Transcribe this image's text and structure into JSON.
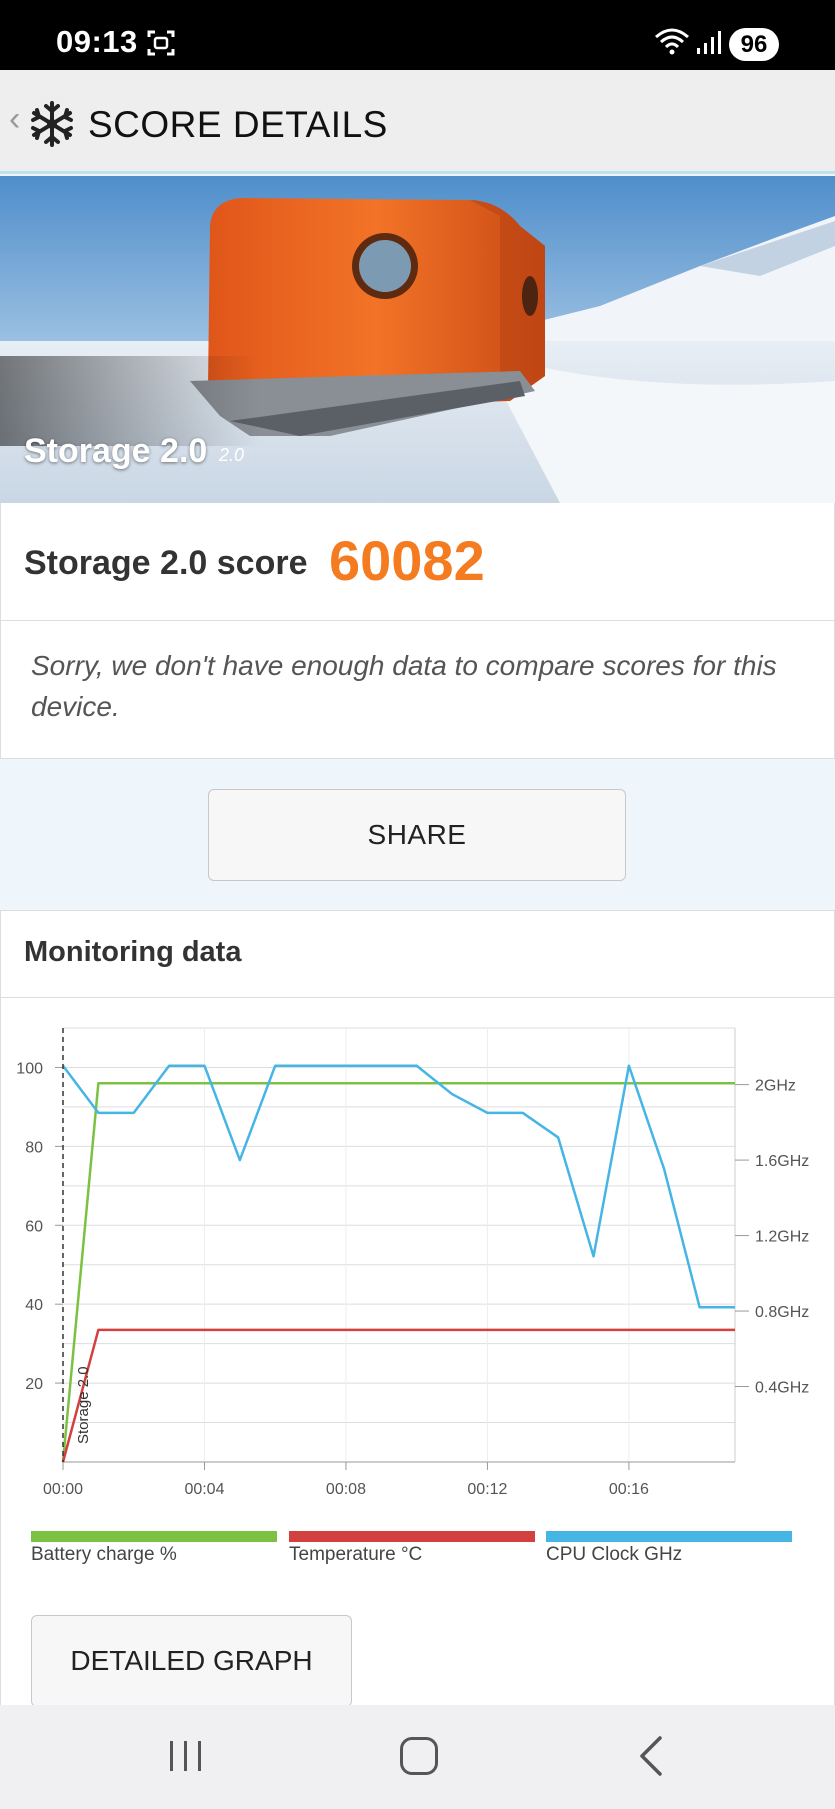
{
  "status_bar": {
    "time": "09:13",
    "battery": "96"
  },
  "app_bar": {
    "title": "SCORE DETAILS"
  },
  "hero": {
    "benchmark_name": "Storage 2.0",
    "version": "2.0"
  },
  "score": {
    "label": "Storage 2.0 score",
    "value": "60082",
    "accent_color": "#f47b20"
  },
  "compare": {
    "message": "Sorry, we don't have enough data to compare scores for this device."
  },
  "share_button": {
    "label": "SHARE"
  },
  "monitoring": {
    "title": "Monitoring data",
    "detailed_graph_label": "DETAILED GRAPH",
    "legend": [
      {
        "label": "Battery charge %",
        "color": "#7cc242"
      },
      {
        "label": "Temperature °C",
        "color": "#d2403f"
      },
      {
        "label": "CPU Clock GHz",
        "color": "#45b5e6"
      }
    ]
  },
  "chart_data": {
    "type": "line",
    "x_tick_labels": [
      "00:00",
      "00:04",
      "00:08",
      "00:12",
      "00:16"
    ],
    "y_left_tick_labels": [
      "100",
      "80",
      "60",
      "40",
      "20"
    ],
    "y_right_tick_labels": [
      "2GHz",
      "1.6GHz",
      "1.2GHz",
      "0.8GHz",
      "0.4GHz"
    ],
    "xlim": [
      0,
      19
    ],
    "y_left_lim": [
      0,
      110
    ],
    "y_right_lim": [
      0,
      2.3
    ],
    "grid": true,
    "marker_label": "Storage 2.0",
    "series": [
      {
        "name": "Battery charge %",
        "axis": "left",
        "color": "#7cc242",
        "x": [
          0,
          1,
          19
        ],
        "values": [
          0,
          96,
          96
        ]
      },
      {
        "name": "Temperature °C",
        "axis": "left",
        "color": "#d2403f",
        "x": [
          0,
          1,
          19
        ],
        "values": [
          0,
          33.5,
          33.5
        ]
      },
      {
        "name": "CPU Clock GHz",
        "axis": "right",
        "color": "#45b5e6",
        "x": [
          0,
          1,
          2,
          3,
          4,
          5,
          6,
          7,
          8,
          9,
          10,
          11,
          12,
          13,
          14,
          15,
          16,
          17,
          18,
          19
        ],
        "values": [
          2.1,
          1.85,
          1.85,
          2.1,
          2.1,
          1.6,
          2.1,
          2.1,
          2.1,
          2.1,
          2.1,
          1.95,
          1.85,
          1.85,
          1.72,
          1.09,
          2.1,
          1.55,
          0.82,
          0.82
        ]
      }
    ]
  }
}
